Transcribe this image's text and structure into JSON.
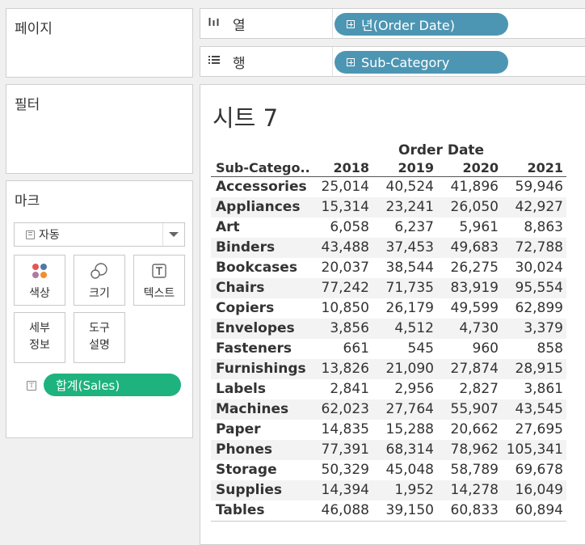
{
  "panels": {
    "pages_title": "페이지",
    "filters_title": "필터",
    "marks_title": "마크"
  },
  "marks": {
    "type_label": "자동",
    "cards": {
      "color": "색상",
      "size": "크기",
      "text": "텍스트",
      "detail": "세부\n정보",
      "tooltip": "도구\n설명"
    },
    "text_field": "합계(Sales)"
  },
  "shelves": {
    "columns_label": "열",
    "columns_pill": "년(Order Date)",
    "rows_label": "행",
    "rows_pill": "Sub-Category"
  },
  "view": {
    "sheet_title": "시트 7",
    "column_group_header": "Order Date",
    "row_header": "Sub-Catego..",
    "years": [
      "2018",
      "2019",
      "2020",
      "2021"
    ],
    "rows": [
      {
        "name": "Accessories",
        "values": [
          "25,014",
          "40,524",
          "41,896",
          "59,946"
        ]
      },
      {
        "name": "Appliances",
        "values": [
          "15,314",
          "23,241",
          "26,050",
          "42,927"
        ]
      },
      {
        "name": "Art",
        "values": [
          "6,058",
          "6,237",
          "5,961",
          "8,863"
        ]
      },
      {
        "name": "Binders",
        "values": [
          "43,488",
          "37,453",
          "49,683",
          "72,788"
        ]
      },
      {
        "name": "Bookcases",
        "values": [
          "20,037",
          "38,544",
          "26,275",
          "30,024"
        ]
      },
      {
        "name": "Chairs",
        "values": [
          "77,242",
          "71,735",
          "83,919",
          "95,554"
        ]
      },
      {
        "name": "Copiers",
        "values": [
          "10,850",
          "26,179",
          "49,599",
          "62,899"
        ]
      },
      {
        "name": "Envelopes",
        "values": [
          "3,856",
          "4,512",
          "4,730",
          "3,379"
        ]
      },
      {
        "name": "Fasteners",
        "values": [
          "661",
          "545",
          "960",
          "858"
        ]
      },
      {
        "name": "Furnishings",
        "values": [
          "13,826",
          "21,090",
          "27,874",
          "28,915"
        ]
      },
      {
        "name": "Labels",
        "values": [
          "2,841",
          "2,956",
          "2,827",
          "3,861"
        ]
      },
      {
        "name": "Machines",
        "values": [
          "62,023",
          "27,764",
          "55,907",
          "43,545"
        ]
      },
      {
        "name": "Paper",
        "values": [
          "14,835",
          "15,288",
          "20,662",
          "27,695"
        ]
      },
      {
        "name": "Phones",
        "values": [
          "77,391",
          "68,314",
          "78,962",
          "105,341"
        ]
      },
      {
        "name": "Storage",
        "values": [
          "50,329",
          "45,048",
          "58,789",
          "69,678"
        ]
      },
      {
        "name": "Supplies",
        "values": [
          "14,394",
          "1,952",
          "14,278",
          "16,049"
        ]
      },
      {
        "name": "Tables",
        "values": [
          "46,088",
          "39,150",
          "60,833",
          "60,894"
        ]
      }
    ]
  },
  "colors": {
    "shelf_pill": "#4d96b3",
    "measure_pill": "#1db27e",
    "color_dots": [
      "#e15759",
      "#4e79a7",
      "#b07aa1",
      "#f28e2b"
    ]
  }
}
